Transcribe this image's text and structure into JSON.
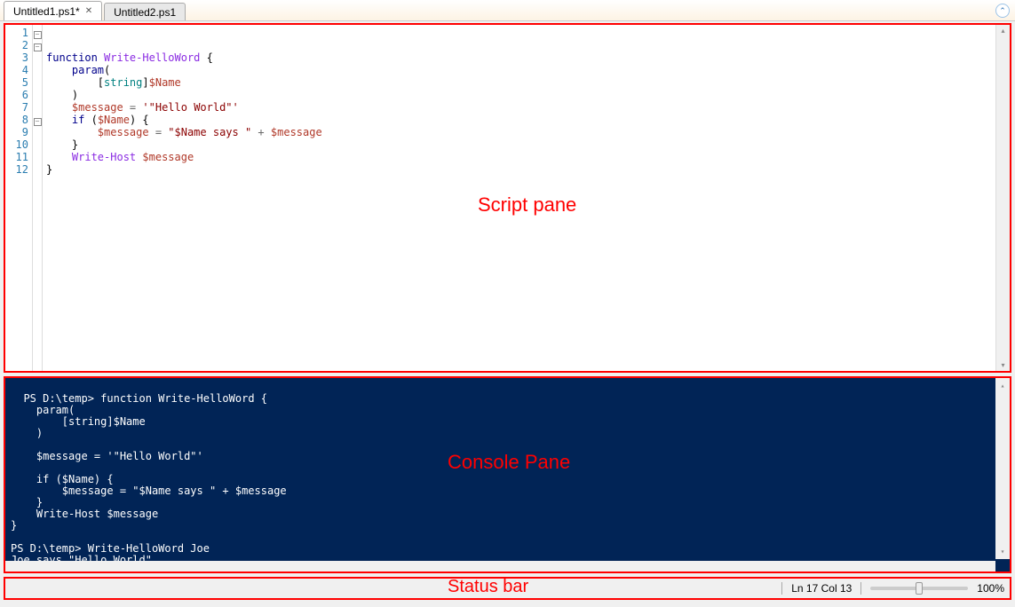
{
  "tabs": [
    {
      "label": "Untitled1.ps1*",
      "active": true,
      "closeable": true
    },
    {
      "label": "Untitled2.ps1",
      "active": false,
      "closeable": false
    }
  ],
  "overlays": {
    "script": "Script pane",
    "console": "Console Pane",
    "status": "Status bar"
  },
  "script": {
    "line_numbers": [
      "1",
      "2",
      "3",
      "4",
      "5",
      "6",
      "7",
      "8",
      "9",
      "10",
      "11",
      "12"
    ],
    "lines": [
      [
        {
          "t": "function ",
          "c": "kw"
        },
        {
          "t": "Write-HelloWord ",
          "c": "fn"
        },
        {
          "t": "{",
          "c": ""
        }
      ],
      [
        {
          "t": "    ",
          "c": ""
        },
        {
          "t": "param",
          "c": "kw"
        },
        {
          "t": "(",
          "c": ""
        }
      ],
      [
        {
          "t": "        ",
          "c": ""
        },
        {
          "t": "[",
          "c": ""
        },
        {
          "t": "string",
          "c": "ty"
        },
        {
          "t": "]",
          "c": ""
        },
        {
          "t": "$Name",
          "c": "var"
        }
      ],
      [
        {
          "t": "    )",
          "c": ""
        }
      ],
      [
        {
          "t": "",
          "c": ""
        }
      ],
      [
        {
          "t": "    ",
          "c": ""
        },
        {
          "t": "$message",
          "c": "var"
        },
        {
          "t": " = ",
          "c": "op"
        },
        {
          "t": "'\"Hello World\"'",
          "c": "str"
        }
      ],
      [
        {
          "t": "",
          "c": ""
        }
      ],
      [
        {
          "t": "    ",
          "c": ""
        },
        {
          "t": "if ",
          "c": "kw"
        },
        {
          "t": "(",
          "c": ""
        },
        {
          "t": "$Name",
          "c": "var"
        },
        {
          "t": ") {",
          "c": ""
        }
      ],
      [
        {
          "t": "        ",
          "c": ""
        },
        {
          "t": "$message",
          "c": "var"
        },
        {
          "t": " = ",
          "c": "op"
        },
        {
          "t": "\"$Name says \"",
          "c": "str"
        },
        {
          "t": " + ",
          "c": "op"
        },
        {
          "t": "$message",
          "c": "var"
        }
      ],
      [
        {
          "t": "    }",
          "c": ""
        }
      ],
      [
        {
          "t": "    ",
          "c": ""
        },
        {
          "t": "Write-Host ",
          "c": "fn"
        },
        {
          "t": "$message",
          "c": "var"
        }
      ],
      [
        {
          "t": "}",
          "c": ""
        }
      ]
    ],
    "folds": [
      "box",
      "box",
      "",
      "",
      "",
      "",
      "",
      "box",
      "",
      "",
      "",
      ""
    ]
  },
  "console": {
    "text": "PS D:\\temp> function Write-HelloWord {\n    param(\n        [string]$Name\n    )\n\n    $message = '\"Hello World\"'\n\n    if ($Name) {\n        $message = \"$Name says \" + $message\n    }\n    Write-Host $message\n}\n\nPS D:\\temp> Write-HelloWord Joe\nJoe says \"Hello World\"\n\nPS D:\\temp>"
  },
  "status": {
    "position": "Ln 17  Col 13",
    "zoom_label": "100%"
  },
  "icons": {
    "close": "✕",
    "chevron_up": "⌃",
    "up": "▴",
    "down": "▾"
  }
}
